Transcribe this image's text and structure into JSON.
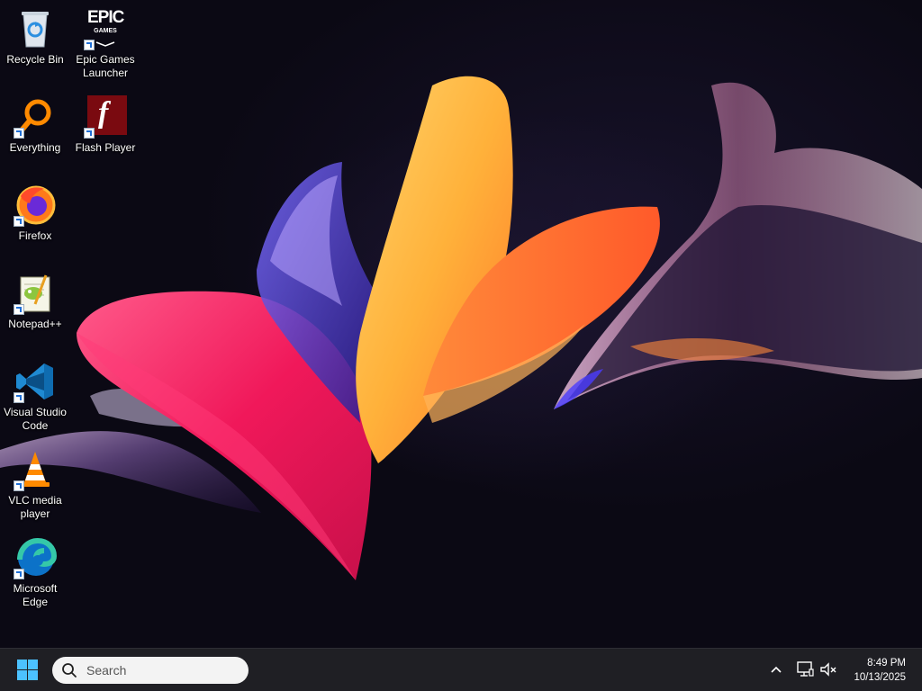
{
  "desktop": {
    "icons": [
      {
        "id": "recycle-bin",
        "label": "Recycle Bin",
        "icon": "recycle-bin-icon",
        "shortcut": false
      },
      {
        "id": "epic-games",
        "label": "Epic Games Launcher",
        "icon": "epic-games-icon",
        "shortcut": true,
        "logo_text": "EPIC",
        "logo_sub": "GAMES"
      },
      {
        "id": "everything",
        "label": "Everything",
        "icon": "everything-search-icon",
        "shortcut": true
      },
      {
        "id": "flash-player",
        "label": "Flash Player",
        "icon": "flash-player-icon",
        "shortcut": true,
        "logo_text": "f"
      },
      {
        "id": "firefox",
        "label": "Firefox",
        "icon": "firefox-icon",
        "shortcut": true
      },
      {
        "id": "notepadpp",
        "label": "Notepad++",
        "icon": "notepadpp-icon",
        "shortcut": true
      },
      {
        "id": "vscode",
        "label": "Visual Studio Code",
        "icon": "vscode-icon",
        "shortcut": true
      },
      {
        "id": "vlc",
        "label": "VLC media player",
        "icon": "vlc-icon",
        "shortcut": true
      },
      {
        "id": "edge",
        "label": "Microsoft Edge",
        "icon": "edge-icon",
        "shortcut": true
      }
    ]
  },
  "taskbar": {
    "start_icon": "windows-start-icon",
    "search_placeholder": "Search",
    "search_icon": "search-icon",
    "tray": {
      "chevron_icon": "chevron-up-icon",
      "network_icon": "network-icon",
      "volume_icon": "volume-muted-icon",
      "time": "8:49 PM",
      "date": "10/13/2025"
    }
  },
  "colors": {
    "accent": "#4cc2ff",
    "taskbar_bg": "#1f1f24",
    "wallpaper_bg": "#0b0914"
  }
}
